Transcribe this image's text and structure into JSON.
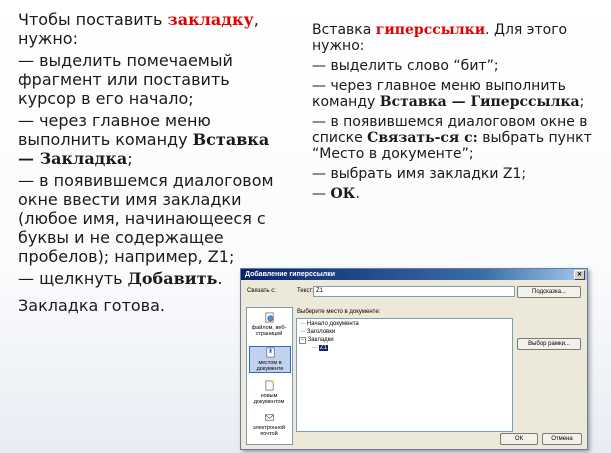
{
  "left": {
    "p1_pre": "Чтобы поставить ",
    "p1_red": "закладку",
    "p1_post": ", нужно:",
    "p2": "— выделить помечаемый фрагмент или поставить курсор в его начало;",
    "p3_pre": "— через главное меню выполнить команду ",
    "p3_bold": "Вставка — Закладка",
    "p3_post": ";",
    "p4": "— в появившемся диалоговом окне ввести имя закладки (любое имя, начинающееся с буквы и не содержащее пробелов); например, Z1;",
    "p5_pre": "— щелкнуть ",
    "p5_bold": "Добавить",
    "p5_post": ".",
    "p6": "Закладка готова."
  },
  "right": {
    "p1_pre": "Вставка ",
    "p1_red": "гиперссылки",
    "p1_post": ". Для этого нужно:",
    "p2": "— выделить слово “бит”;",
    "p3_pre": "— через главное меню выполнить команду ",
    "p3_bold": "Вставка — Гиперссылка",
    "p3_post": ";",
    "p4_pre": "— в появившемся диалоговом окне в списке ",
    "p4_bold": "Связать-ся с:",
    "p4_post": " выбрать пункт “Место в документе”;",
    "p5": "— выбрать имя закладки Z1;",
    "p6_pre": "— ",
    "p6_bold": "ОК",
    "p6_post": "."
  },
  "dialog": {
    "title": "Добавление гиперссылки",
    "link_with_label": "Связать с:",
    "text_label": "Текст:",
    "text_value": "Z1",
    "hint_button": "Подсказка...",
    "place_label": "Выберите место в документе:",
    "tree": {
      "doc_start": "Начало документа",
      "headings": "Заголовки",
      "bookmarks": "Закладки",
      "bookmark_item": "Z1"
    },
    "frame_button": "Выбор рамки...",
    "link_buttons": {
      "file": "файлом, веб-страницей",
      "place": "местом в документе",
      "new_doc": "новым документом",
      "email": "электронной почтой"
    },
    "ok": "ОК",
    "cancel": "Отмена"
  }
}
